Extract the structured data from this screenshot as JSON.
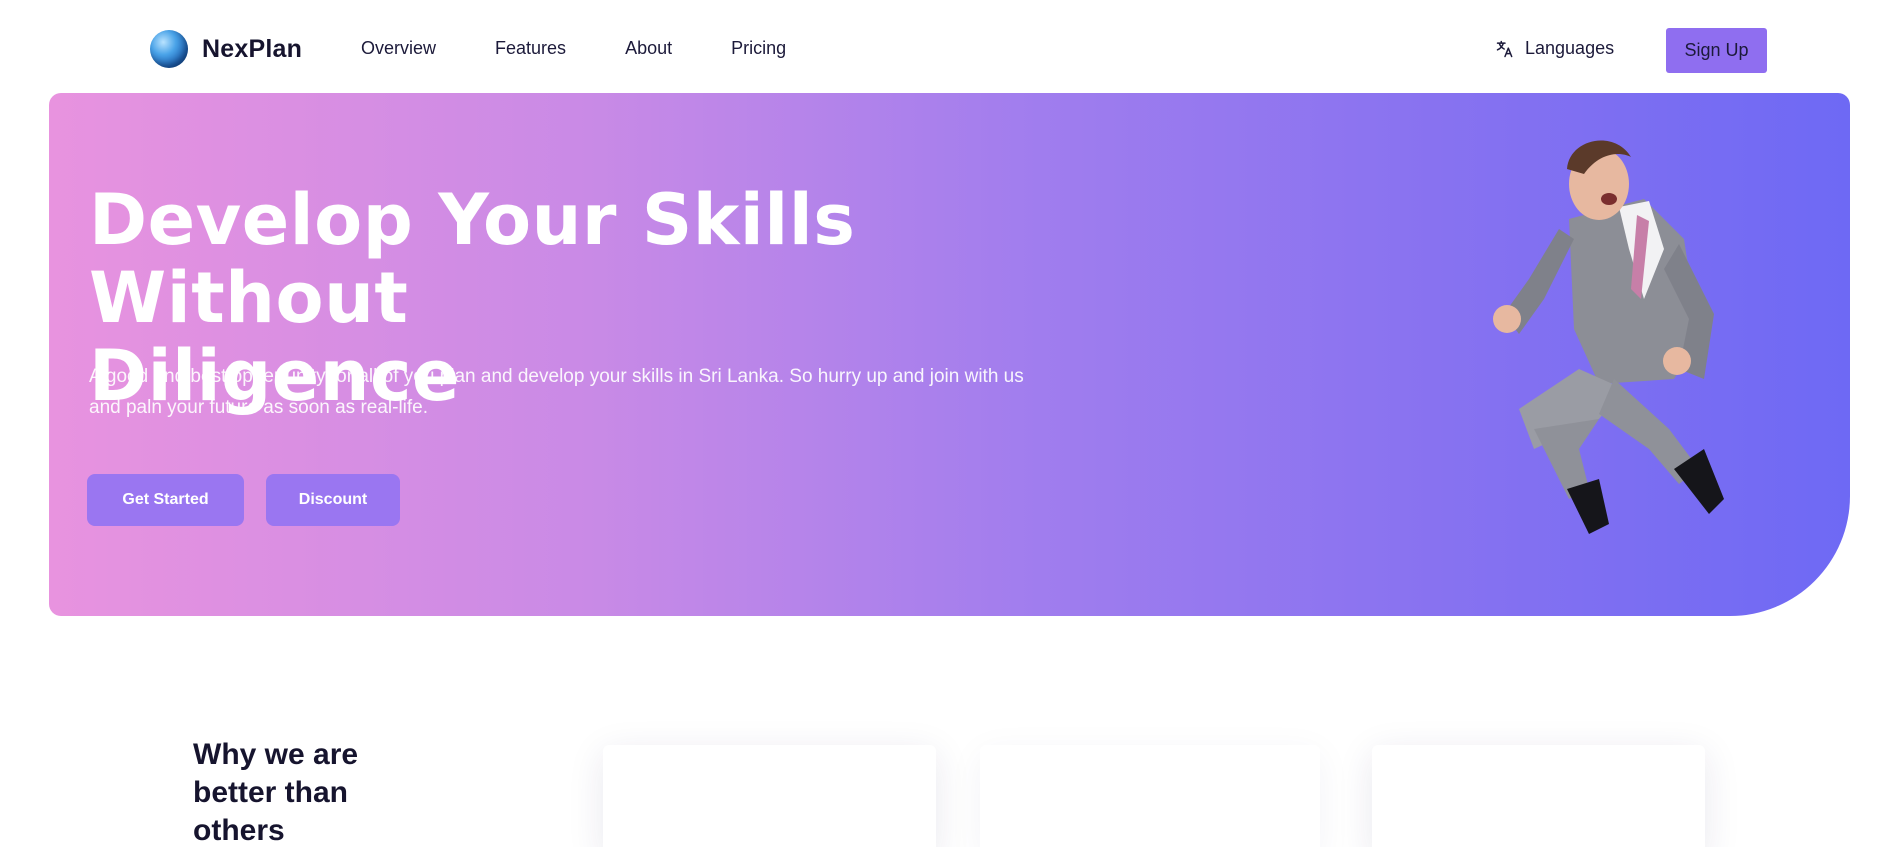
{
  "nav": {
    "brand": "NexPlan",
    "links": [
      "Overview",
      "Features",
      "About",
      "Pricing"
    ],
    "languages_label": "Languages",
    "signup_label": "Sign Up"
  },
  "hero": {
    "title_line1": "Develop Your Skills Without",
    "title_line2": "Diligence",
    "subtitle_line1": "A good and best oppertunity for all of you plan and develop your skills in Sri Lanka. So hurry up and join with us",
    "subtitle_line2": "and paln your future as soon as real-life.",
    "primary_button": "Get Started",
    "secondary_button": "Discount",
    "gradient_start": "#e893df",
    "gradient_end": "#6e69f4"
  },
  "why": {
    "heading_line1": "Why we are",
    "heading_line2": "better than",
    "heading_line3": "others"
  },
  "icons": {
    "logo": "globe-icon",
    "languages": "translate-icon"
  },
  "colors": {
    "accent": "#8f6ef0",
    "text_dark": "#16142e"
  }
}
